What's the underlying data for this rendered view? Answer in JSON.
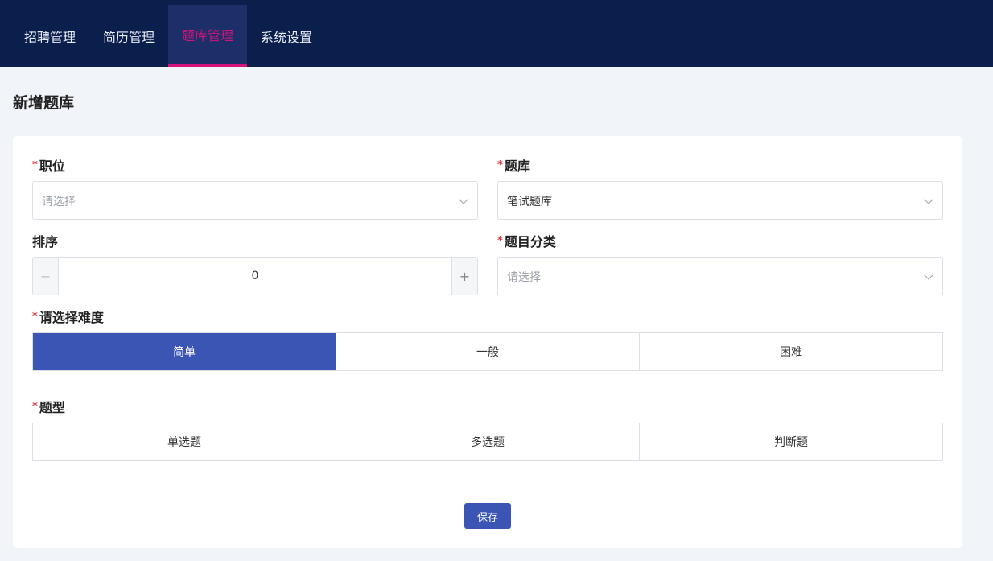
{
  "nav": {
    "items": [
      {
        "label": "招聘管理"
      },
      {
        "label": "简历管理"
      },
      {
        "label": "题库管理"
      },
      {
        "label": "系统设置"
      }
    ],
    "active_index": 2
  },
  "page": {
    "title": "新增题库"
  },
  "form": {
    "required_mark": "*",
    "position": {
      "label": "职位",
      "placeholder": "请选择",
      "value": ""
    },
    "bank": {
      "label": "题库",
      "value": "笔试题库"
    },
    "sort": {
      "label": "排序",
      "value": "0",
      "minus": "−",
      "plus": "+"
    },
    "category": {
      "label": "题目分类",
      "placeholder": "请选择",
      "value": ""
    },
    "difficulty": {
      "label": "请选择难度",
      "options": [
        "简单",
        "一般",
        "困难"
      ],
      "selected_index": 0
    },
    "type": {
      "label": "题型",
      "options": [
        "单选题",
        "多选题",
        "判断题"
      ],
      "selected_index": null
    },
    "save_label": "保存"
  },
  "colors": {
    "nav_bg": "#0b1f4c",
    "nav_active": "#d4127a",
    "primary": "#3b55b4",
    "required": "#e0393e"
  }
}
